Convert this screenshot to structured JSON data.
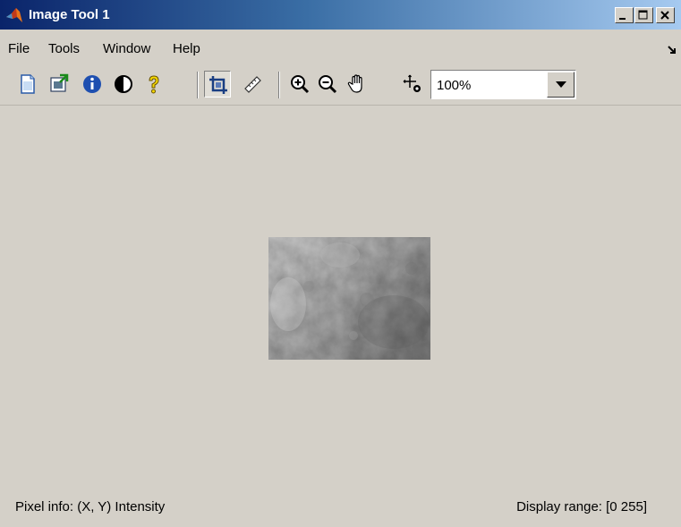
{
  "window": {
    "title": "Image Tool 1"
  },
  "menu": {
    "items": [
      "File",
      "Tools",
      "Window",
      "Help"
    ]
  },
  "toolbar": {
    "buttons": [
      {
        "icon": "new-figure-icon"
      },
      {
        "icon": "export-icon"
      },
      {
        "icon": "image-information-icon"
      },
      {
        "icon": "adjust-contrast-icon"
      },
      {
        "icon": "help-icon"
      },
      {
        "icon": "crop-icon",
        "pressed": true
      },
      {
        "icon": "measure-distance-icon"
      },
      {
        "icon": "zoom-in-icon"
      },
      {
        "icon": "zoom-out-icon"
      },
      {
        "icon": "pan-icon"
      },
      {
        "icon": "pixel-region-icon"
      }
    ],
    "zoom": {
      "value": "100%"
    }
  },
  "status": {
    "pixel_info": "Pixel info: (X, Y)  Intensity",
    "display_range": "Display range: [0 255]"
  },
  "colors": {
    "title_start": "#0a246a",
    "title_end": "#a6caf0",
    "face": "#d4d0c8"
  }
}
